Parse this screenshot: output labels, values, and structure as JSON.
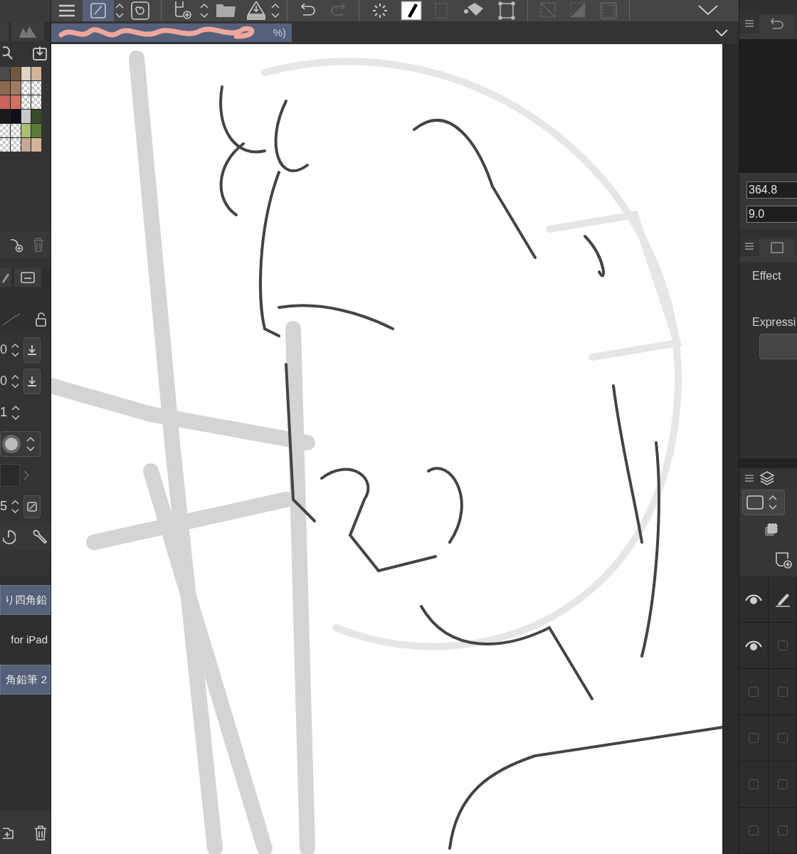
{
  "document_tab": {
    "title_tail": "%)"
  },
  "color_swatches": [
    {
      "kind": "color",
      "color": "#4a4a4a"
    },
    {
      "kind": "color",
      "color": "#6e5a40"
    },
    {
      "kind": "color",
      "color": "#e0d2c4"
    },
    {
      "kind": "color",
      "color": "#d2b49a"
    },
    {
      "kind": "color",
      "color": "#8a6a50"
    },
    {
      "kind": "color",
      "color": "#a07c64"
    },
    {
      "kind": "empty"
    },
    {
      "kind": "empty"
    },
    {
      "kind": "color",
      "color": "#c8645a"
    },
    {
      "kind": "color",
      "color": "#d27060"
    },
    {
      "kind": "empty"
    },
    {
      "kind": "empty"
    },
    {
      "kind": "color",
      "color": "#1a1a1a"
    },
    {
      "kind": "color",
      "color": "#101018"
    },
    {
      "kind": "color",
      "color": "#c8c8c8"
    },
    {
      "kind": "color",
      "color": "#3a4a2a"
    },
    {
      "kind": "empty"
    },
    {
      "kind": "empty"
    },
    {
      "kind": "color",
      "color": "#a8c070"
    },
    {
      "kind": "color",
      "color": "#5a7a3a"
    },
    {
      "kind": "empty"
    },
    {
      "kind": "empty"
    },
    {
      "kind": "color",
      "color": "#c8a890"
    },
    {
      "kind": "color",
      "color": "#d2b49a"
    }
  ],
  "tool_properties": [
    {
      "kind": "default",
      "value": "0"
    },
    {
      "kind": "default",
      "value": "0"
    },
    {
      "kind": "number",
      "value": "1"
    },
    {
      "kind": "shape"
    },
    {
      "kind": "swatch"
    },
    {
      "kind": "pressure",
      "value": "5"
    }
  ],
  "sub_tools": [
    {
      "label": "り四角鉛",
      "selected": true
    },
    {
      "label": "for iPad",
      "selected": false
    },
    {
      "label": "角鉛筆 2",
      "selected": true
    }
  ],
  "navigator": {
    "values": [
      "364.8",
      "9.0"
    ]
  },
  "effect_panel": {
    "sections": [
      "Effect",
      "Expressi"
    ]
  },
  "layers": [
    {
      "visible": true,
      "editing": true
    },
    {
      "visible": true,
      "editing": false
    },
    {
      "visible": false,
      "editing": false
    },
    {
      "visible": false,
      "editing": false
    },
    {
      "visible": false,
      "editing": false
    },
    {
      "visible": false,
      "editing": false
    }
  ]
}
